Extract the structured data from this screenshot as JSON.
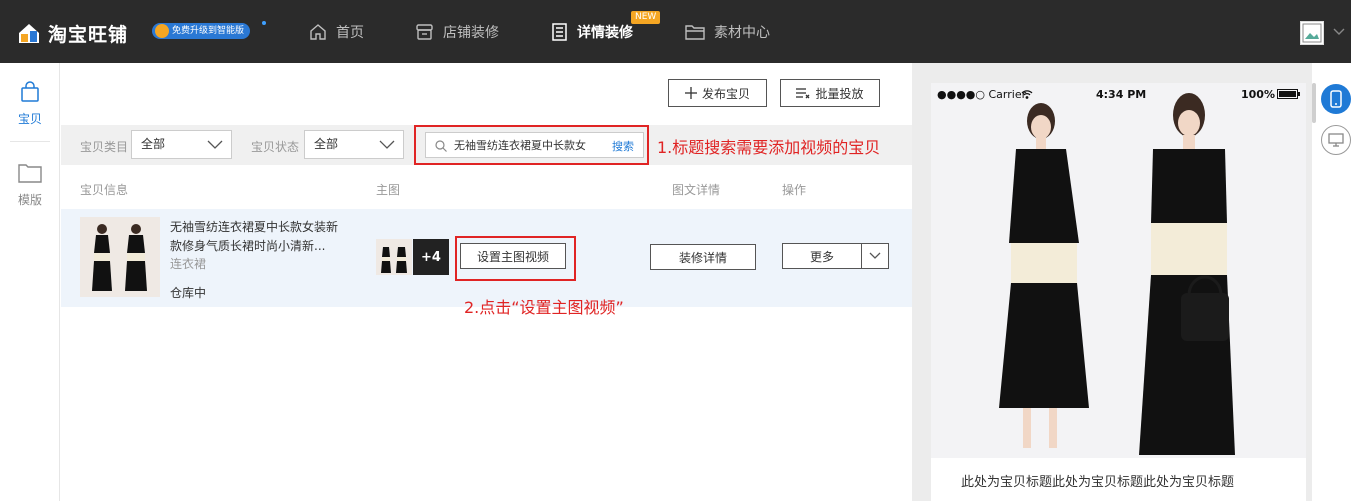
{
  "header": {
    "brand": "淘宝旺铺",
    "upgrade_badge": "免费升级到智能版",
    "nav": [
      {
        "label": "首页",
        "icon": "home-icon"
      },
      {
        "label": "店铺装修",
        "icon": "store-icon"
      },
      {
        "label": "详情装修",
        "icon": "document-icon",
        "active": true,
        "badge": "NEW"
      },
      {
        "label": "素材中心",
        "icon": "folder-icon"
      }
    ]
  },
  "sidebar": {
    "items": [
      {
        "label": "宝贝",
        "icon": "bag-icon",
        "active": true
      },
      {
        "label": "模版",
        "icon": "folder-icon"
      }
    ]
  },
  "toolbar": {
    "publish_label": "发布宝贝",
    "batch_label": "批量投放"
  },
  "filters": {
    "category_label": "宝贝类目",
    "category_value": "全部",
    "status_label": "宝贝状态",
    "status_value": "全部",
    "search_value": "无袖雪纺连衣裙夏中长款女",
    "search_button": "搜索"
  },
  "annotations": {
    "step1": "1.标题搜索需要添加视频的宝贝",
    "step2": "2.点击“设置主图视频”"
  },
  "table": {
    "columns": [
      "宝贝信息",
      "主图",
      "图文详情",
      "操作"
    ],
    "rows": [
      {
        "title": "无袖雪纺连衣裙夏中长款女装新款修身气质长裙时尚小清新...",
        "category": "连衣裙",
        "status": "仓库中",
        "more_images": "+4",
        "set_video_label": "设置主图视频",
        "edit_detail_label": "装修详情",
        "more_label": "更多"
      }
    ]
  },
  "preview": {
    "carrier": "●●●●○ Carrier",
    "time": "4:34 PM",
    "battery": "100%",
    "title_placeholder": "此处为宝贝标题此处为宝贝标题此处为宝贝标题"
  },
  "colors": {
    "topbar": "#2b2b2b",
    "accent": "#1f7ad6",
    "annotation": "#e02424",
    "new_badge": "#f5a623"
  }
}
